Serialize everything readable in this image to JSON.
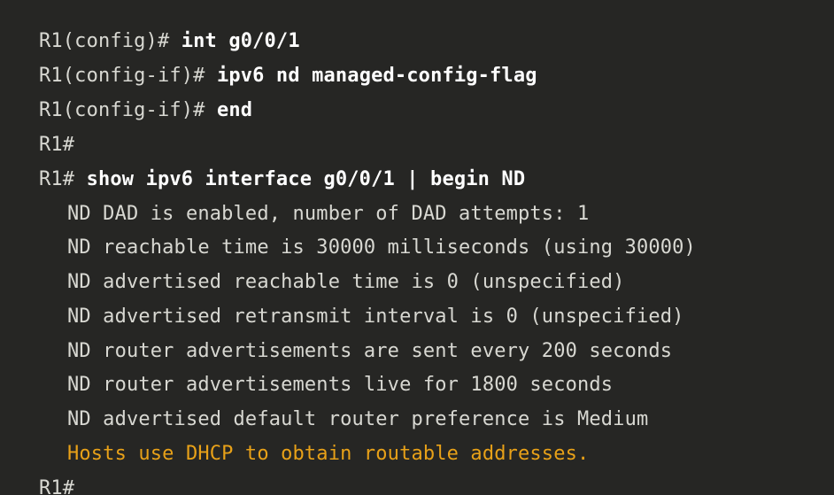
{
  "terminal": {
    "colors": {
      "background": "#262624",
      "text": "#d8d8d2",
      "command": "#ffffff",
      "highlight": "#e8a118"
    },
    "lines": [
      {
        "prompt": "R1(config)#",
        "command": "int g0/0/1"
      },
      {
        "prompt": "R1(config-if)#",
        "command": "ipv6 nd managed-config-flag"
      },
      {
        "prompt": "R1(config-if)#",
        "command": "end"
      },
      {
        "prompt": "R1#",
        "command": ""
      },
      {
        "prompt": "R1#",
        "command": "show ipv6 interface g0/0/1 | begin ND"
      },
      {
        "output": "ND DAD is enabled, number of DAD attempts: 1"
      },
      {
        "output": "ND reachable time is 30000 milliseconds (using 30000)"
      },
      {
        "output": "ND advertised reachable time is 0 (unspecified)"
      },
      {
        "output": "ND advertised retransmit interval is 0 (unspecified)"
      },
      {
        "output": "ND router advertisements are sent every 200 seconds"
      },
      {
        "output": "ND router advertisements live for 1800 seconds"
      },
      {
        "output": "ND advertised default router preference is Medium"
      },
      {
        "output": "Hosts use DHCP to obtain routable addresses."
      },
      {
        "prompt": "R1#",
        "command": ""
      }
    ]
  }
}
